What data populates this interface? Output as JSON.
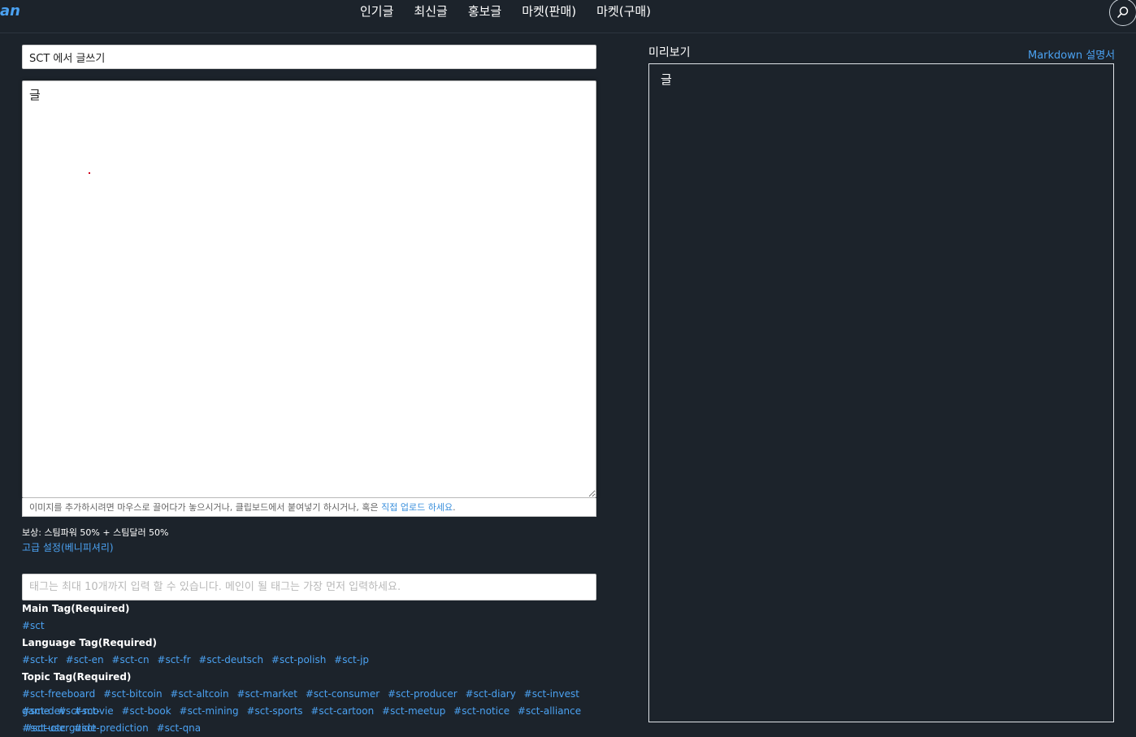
{
  "header": {
    "logo_fragment": "an",
    "nav": [
      "인기글",
      "최신글",
      "홍보글",
      "마켓(판매)",
      "마켓(구매)"
    ]
  },
  "editor": {
    "title_value": "SCT 에서 글쓰기",
    "body_value": "글",
    "upload_hint_prefix": "이미지를 추가하시려면 마우스로 끌어다가 놓으시거나, 클립보드에서 붙여넣기 하시거나, 혹은 ",
    "upload_hint_link": "직접 업로드 하세요",
    "upload_hint_suffix": ".",
    "reward_text": "보상: 스팀파워 50% + 스팀달러 50%",
    "advanced_link": "고급 설정(베니피셔리)",
    "tag_placeholder": "태그는 최대 10개까지 입력 할 수 있습니다. 메인이 될 태그는 가장 먼저 입력하세요."
  },
  "tags": {
    "main_heading": "Main Tag(Required)",
    "main_tags": [
      "#sct"
    ],
    "language_heading": "Language Tag(Required)",
    "language_tags": [
      "#sct-kr",
      "#sct-en",
      "#sct-cn",
      "#sct-fr",
      "#sct-deutsch",
      "#sct-polish",
      "#sct-jp"
    ],
    "topic_heading": "Topic Tag(Required)",
    "topic_line1": [
      "#sct-freeboard",
      "#sct-bitcoin",
      "#sct-altcoin",
      "#sct-market",
      "#sct-consumer",
      "#sct-producer",
      "#sct-diary",
      "#sct-invest",
      "#sct-dev",
      "#sct-"
    ],
    "topic_line2": [
      "game",
      "#sct-movie",
      "#sct-book",
      "#sct-mining",
      "#sct-sports",
      "#sct-cartoon",
      "#sct-meetup",
      "#sct-notice",
      "#sct-alliance",
      "#sct-userguide"
    ],
    "topic_line3": [
      "#sct-otc",
      "#sct-prediction",
      "#sct-qna"
    ]
  },
  "preview": {
    "label": "미리보기",
    "markdown_link": "Markdown 설명서",
    "content": "글"
  },
  "colors": {
    "background": "#1c232b",
    "link": "#4ba2f2"
  }
}
